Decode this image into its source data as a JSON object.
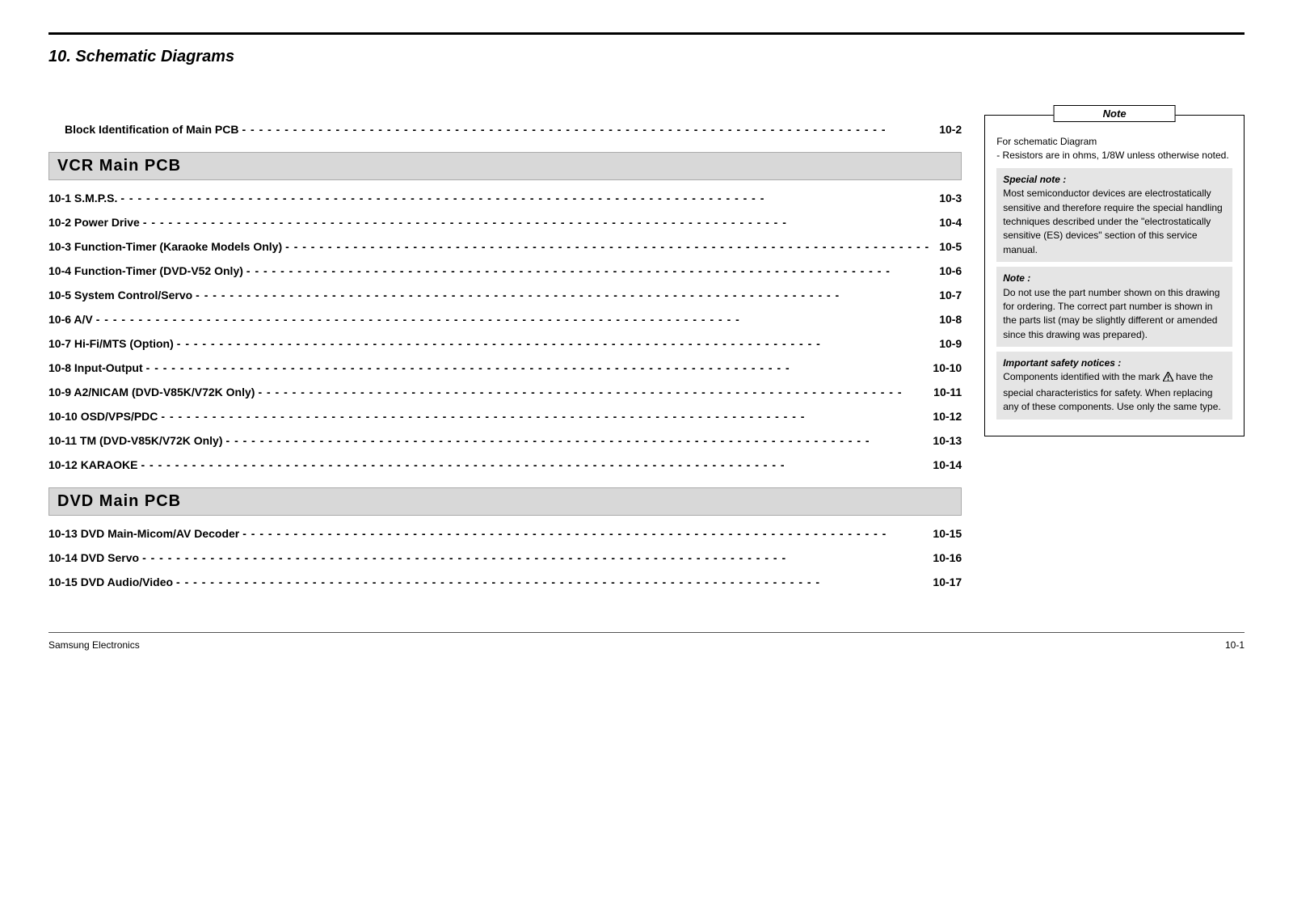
{
  "chapter_title": "10. Schematic Diagrams",
  "top_entry": {
    "label": "Block Identification of Main PCB",
    "page": "10-2"
  },
  "sections": [
    {
      "header": "VCR Main PCB",
      "items": [
        {
          "label": "10-1  S.M.P.S.",
          "page": "10-3"
        },
        {
          "label": "10-2  Power Drive",
          "page": "10-4"
        },
        {
          "label": "10-3  Function-Timer (Karaoke Models Only)",
          "page": "10-5"
        },
        {
          "label": "10-4  Function-Timer (DVD-V52 Only)",
          "page": "10-6"
        },
        {
          "label": "10-5  System Control/Servo",
          "page": "10-7"
        },
        {
          "label": "10-6  A/V",
          "page": "10-8"
        },
        {
          "label": "10-7  Hi-Fi/MTS (Option)",
          "page": "10-9"
        },
        {
          "label": "10-8  Input-Output",
          "page": "10-10"
        },
        {
          "label": "10-9  A2/NICAM (DVD-V85K/V72K Only)",
          "page": "10-11"
        },
        {
          "label": "10-10  OSD/VPS/PDC",
          "page": "10-12"
        },
        {
          "label": "10-11  TM (DVD-V85K/V72K Only)",
          "page": "10-13"
        },
        {
          "label": "10-12  KARAOKE",
          "page": "10-14"
        }
      ]
    },
    {
      "header": "DVD Main PCB",
      "items": [
        {
          "label": "10-13  DVD Main-Micom/AV Decoder",
          "page": "10-15"
        },
        {
          "label": "10-14  DVD Servo",
          "page": "10-16"
        },
        {
          "label": "10-15  DVD Audio/Video",
          "page": "10-17"
        }
      ]
    }
  ],
  "note": {
    "tab": "Note",
    "intro1": "For schematic Diagram",
    "intro2": "- Resistors are in ohms, 1/8W unless otherwise noted.",
    "special_title": "Special note :",
    "special_body": "Most semiconductor devices are electrostatically sensitive and therefore require the special handling techniques described under the \"electrostatically sensitive (ES) devices\" section of this service manual.",
    "note_title": "Note :",
    "note_body": "Do not use the part number shown on this drawing for ordering. The correct part number is shown in the parts list (may be slightly different or amended since this drawing was prepared).",
    "safety_title": "Important safety notices :",
    "safety_pre": "Components identified with the mark ",
    "safety_post": " have the special characteristics for safety. When replacing any of these components. Use only the same type."
  },
  "footer": {
    "left": "Samsung Electronics",
    "right": "10-1"
  }
}
